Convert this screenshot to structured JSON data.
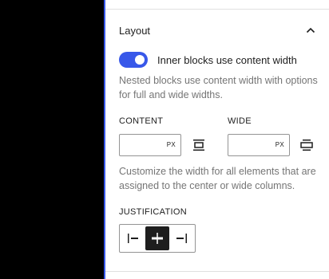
{
  "layout_panel": {
    "title": "Layout",
    "toggle_label": "Inner blocks use content width",
    "toggle_on": true,
    "toggle_help": "Nested blocks use content width with options for full and wide widths.",
    "content_label": "CONTENT",
    "content_value": "",
    "content_unit": "PX",
    "wide_label": "WIDE",
    "wide_value": "",
    "wide_unit": "PX",
    "width_help": "Customize the width for all elements that are assigned to the center or wide columns.",
    "justification_label": "JUSTIFICATION",
    "justification_options": [
      "left",
      "center",
      "right"
    ],
    "justification_selected": "center"
  },
  "colors": {
    "accent": "#3858e9",
    "text": "#1e1e1e",
    "help_text": "#757575",
    "border": "#949494"
  }
}
